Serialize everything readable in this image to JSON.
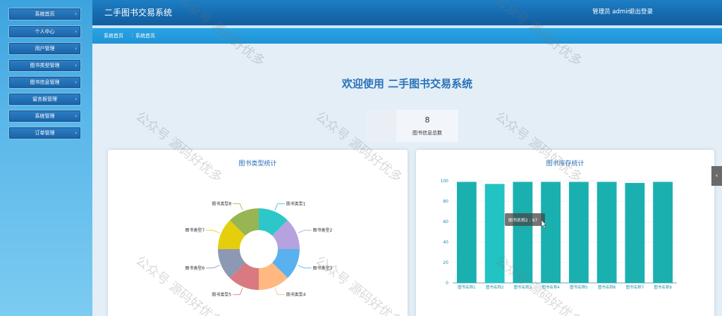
{
  "app": {
    "title": "二手图书交易系统"
  },
  "header": {
    "admin_label": "管理员 admin",
    "logout_label": "退出登录"
  },
  "sidebar": {
    "items": [
      {
        "label": "系统首页"
      },
      {
        "label": "个人中心"
      },
      {
        "label": "用户管理"
      },
      {
        "label": "图书类型管理"
      },
      {
        "label": "图书信息管理"
      },
      {
        "label": "留言板管理"
      },
      {
        "label": "系统管理"
      },
      {
        "label": "订单管理"
      }
    ]
  },
  "breadcrumb": {
    "home": "系统首页",
    "separator": "⋮",
    "current": "系统首页"
  },
  "welcome": "欢迎使用 二手图书交易系统",
  "stat": {
    "value": "8",
    "label": "图书信息总数"
  },
  "watermark": "公众号 源码好优多",
  "colors": {
    "header": "#1669ad",
    "crumbbar": "#1f93d6",
    "accent": "#2a72b8",
    "bar": "#1bb0b0"
  },
  "side_tab_icon": "chevron-left-icon",
  "chart_data": [
    {
      "type": "pie",
      "title": "图书类型统计",
      "categories": [
        "图书类型1",
        "图书类型2",
        "图书类型3",
        "图书类型4",
        "图书类型5",
        "图书类型6",
        "图书类型7",
        "图书类型8"
      ],
      "values": [
        1,
        1,
        1,
        1,
        1,
        1,
        1,
        1
      ],
      "colors": [
        "#2ec7c9",
        "#b6a2de",
        "#5ab1ef",
        "#ffb980",
        "#d87a80",
        "#8d98b3",
        "#e5cf0d",
        "#97b552"
      ],
      "donut": true
    },
    {
      "type": "bar",
      "title": "图书库存统计",
      "categories": [
        "图书名称1",
        "图书名称2",
        "图书名称3",
        "图书名称4",
        "图书名称5",
        "图书名称6",
        "图书名称7",
        "图书名称8"
      ],
      "values": [
        99,
        97,
        99,
        99,
        99,
        99,
        98,
        99
      ],
      "ylim": [
        0,
        100
      ],
      "yticks": [
        0,
        20,
        40,
        60,
        80,
        100
      ],
      "tooltip": "图书名称2 : 97"
    }
  ]
}
